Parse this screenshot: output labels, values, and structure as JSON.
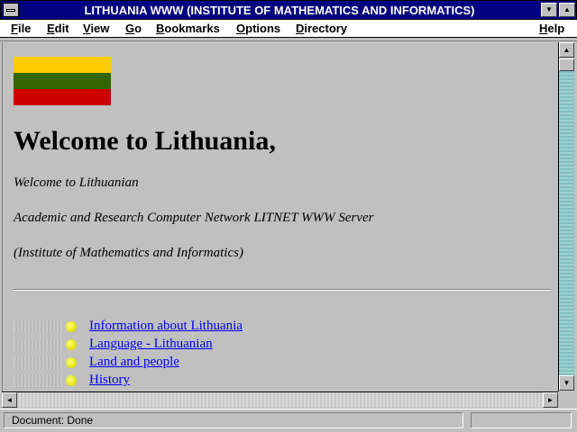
{
  "window": {
    "title": "LITHUANIA WWW (INSTITUTE OF MATHEMATICS AND INFORMATICS)",
    "minimize_glyph": "▼",
    "maximize_glyph": "▲"
  },
  "menu": {
    "file": {
      "hot": "F",
      "rest": "ile"
    },
    "edit": {
      "hot": "E",
      "rest": "dit"
    },
    "view": {
      "hot": "V",
      "rest": "iew"
    },
    "go": {
      "hot": "G",
      "rest": "o"
    },
    "bookmarks": {
      "hot": "B",
      "rest": "ookmarks"
    },
    "options": {
      "hot": "O",
      "rest": "ptions"
    },
    "directory": {
      "hot": "D",
      "rest": "irectory"
    },
    "help": {
      "hot": "H",
      "rest": "elp"
    }
  },
  "page": {
    "flag_colors": [
      "#ffcc00",
      "#336600",
      "#cc0000"
    ],
    "heading": "Welcome to Lithuania,",
    "lines": [
      "Welcome to Lithuanian",
      "Academic and Research Computer Network LITNET WWW Server",
      "(Institute of Mathematics and Informatics)"
    ],
    "links": [
      "Information about Lithuania",
      "Language - Lithuanian",
      "Land and people",
      "History"
    ]
  },
  "scrollbars": {
    "up": "▲",
    "down": "▼",
    "left": "◄",
    "right": "►"
  },
  "status": {
    "text": "Document: Done"
  }
}
